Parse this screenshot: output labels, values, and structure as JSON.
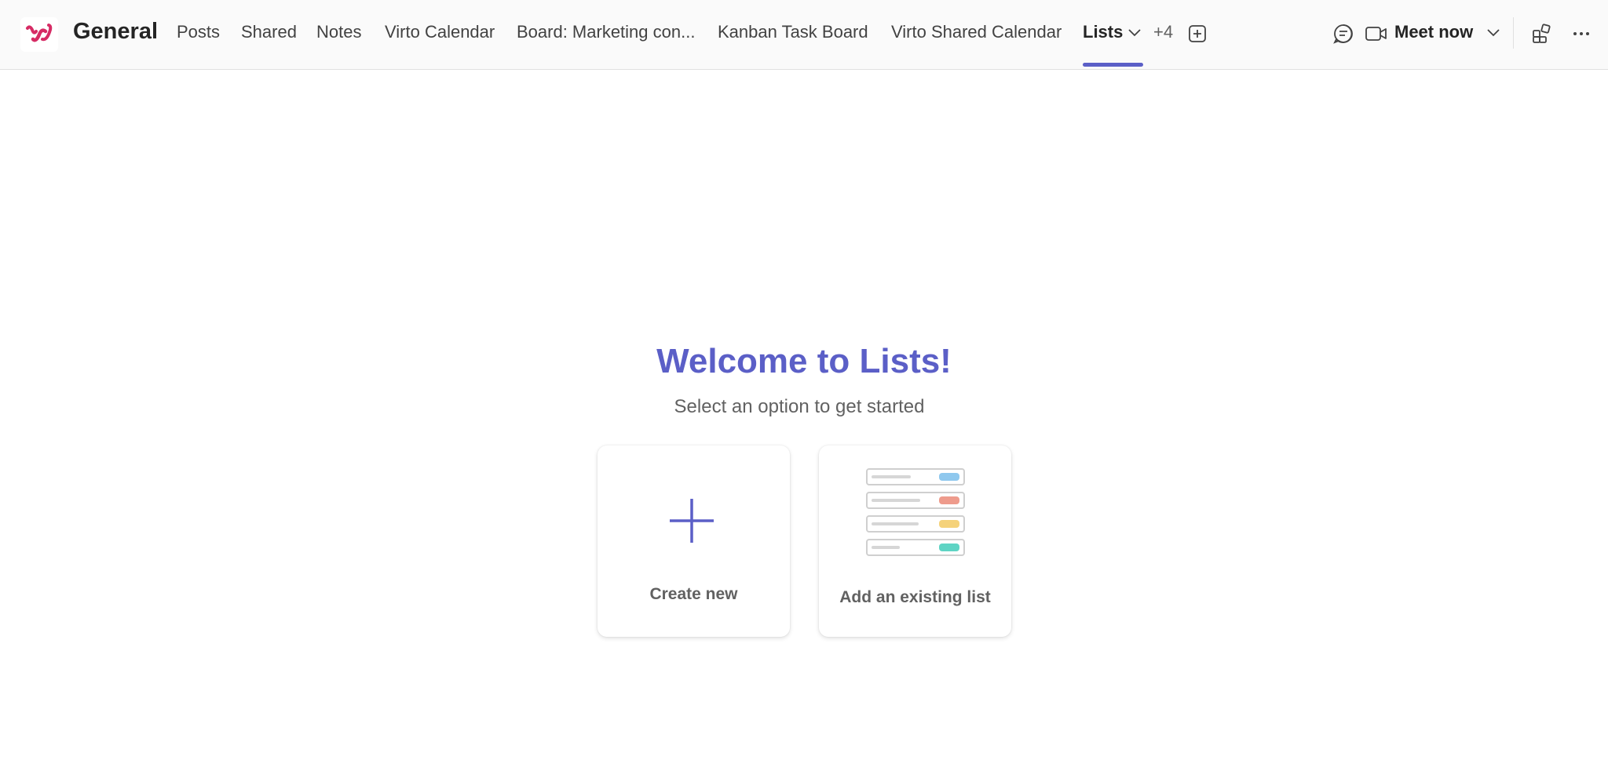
{
  "header": {
    "channel_title": "General",
    "tabs": [
      {
        "label": "Posts"
      },
      {
        "label": "Shared"
      },
      {
        "label": "Notes"
      },
      {
        "label": "Virto Calendar"
      },
      {
        "label": "Board: Marketing con..."
      },
      {
        "label": "Kanban Task Board"
      },
      {
        "label": "Virto Shared Calendar"
      },
      {
        "label": "Lists"
      }
    ],
    "active_tab": "Lists",
    "overflow_count": "+4",
    "meet_now_label": "Meet now"
  },
  "colors": {
    "accent": "#5b5fc7",
    "logo": "#d62b64"
  },
  "icons": [
    "app-logo-icon",
    "chevron-down-icon",
    "add-tab-icon",
    "chat-icon",
    "video-camera-icon",
    "apps-icon",
    "more-icon",
    "plus-icon",
    "list-illustration-icon"
  ],
  "main": {
    "title": "Welcome to Lists!",
    "subtitle": "Select an option to get started",
    "cards": [
      {
        "label": "Create new"
      },
      {
        "label": "Add an existing list"
      }
    ]
  }
}
